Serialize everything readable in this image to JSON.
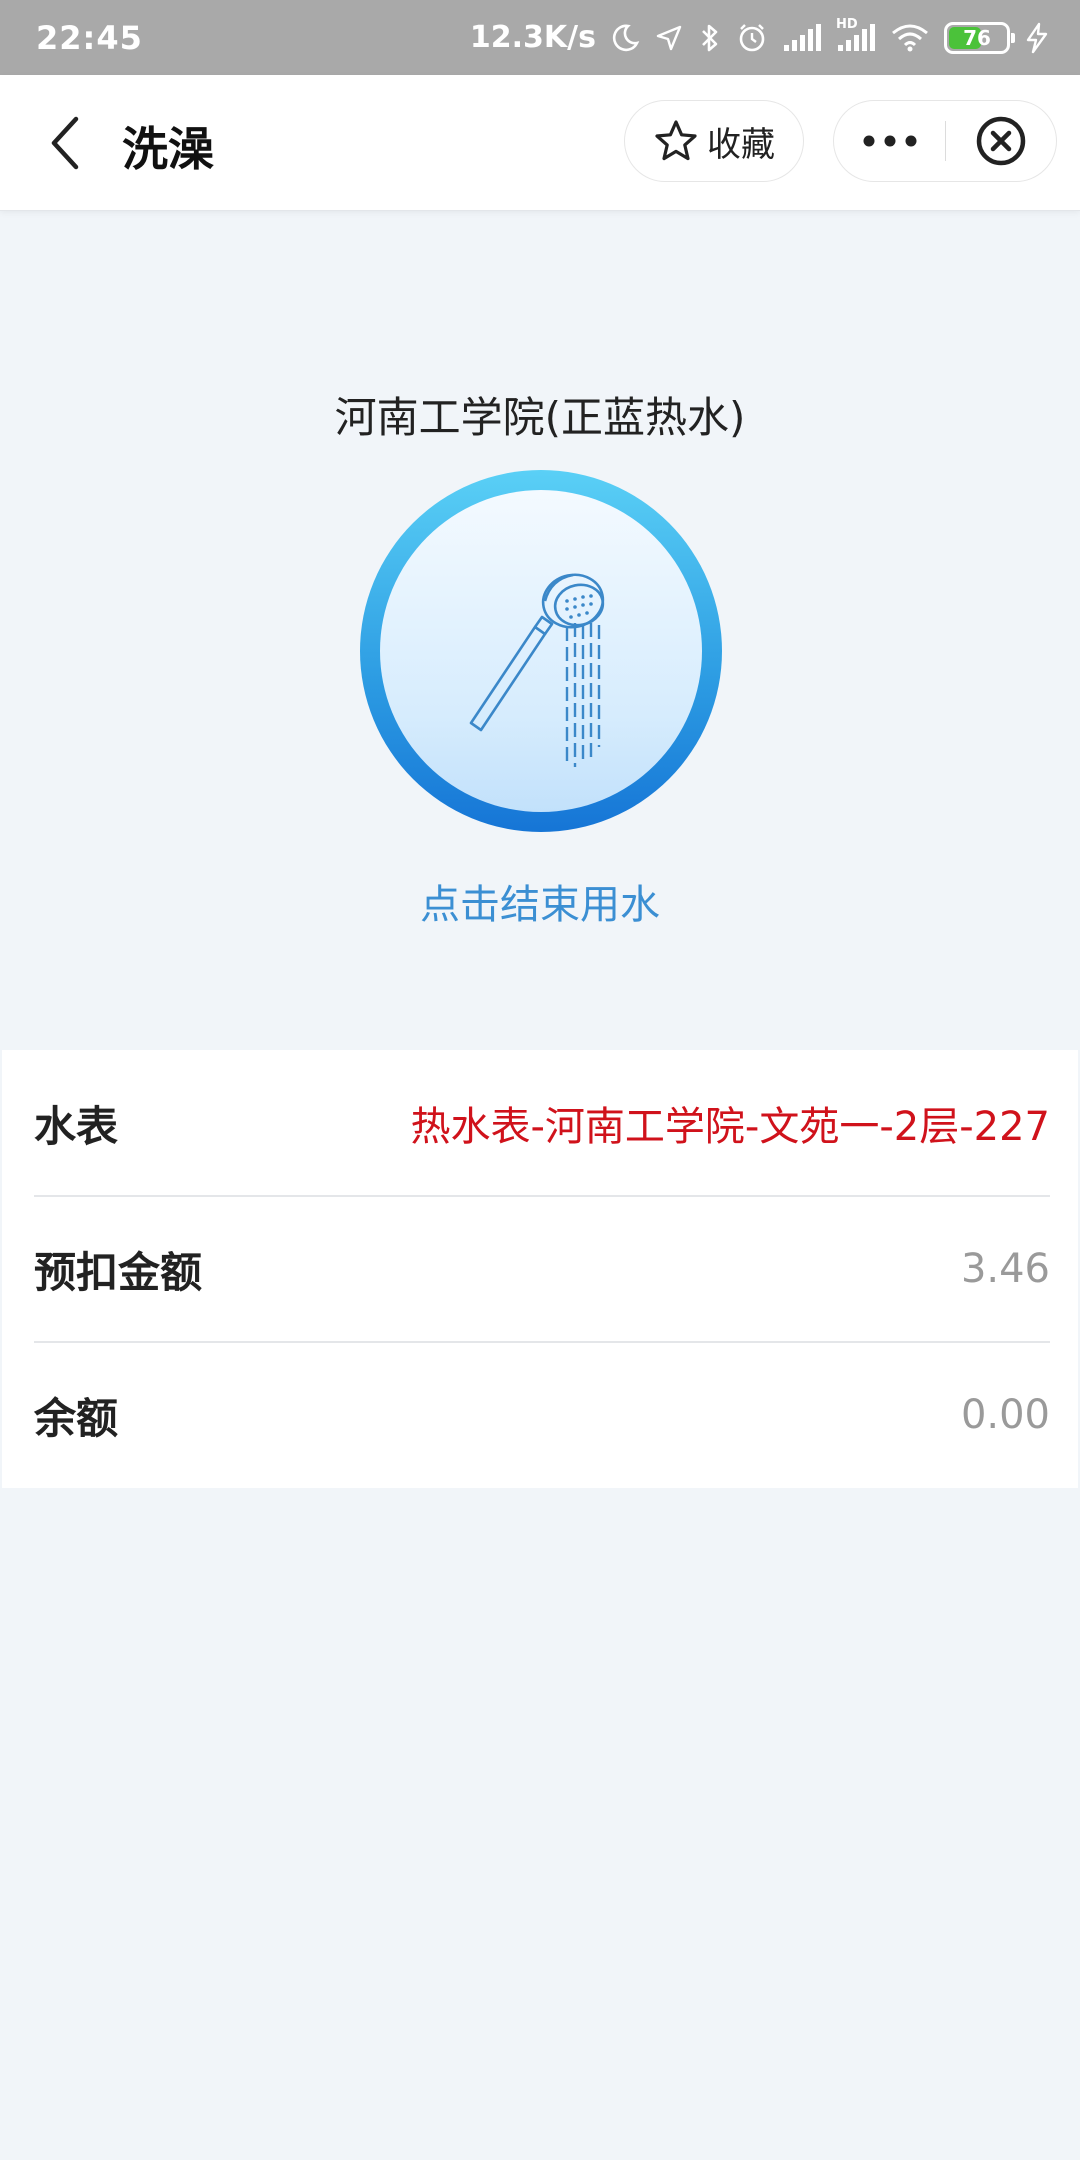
{
  "status_bar": {
    "time": "22:45",
    "network_speed": "12.3K/s",
    "icons": [
      "moon-icon",
      "location-icon",
      "bluetooth-icon",
      "alarm-icon",
      "signal-icon",
      "hd-signal-icon",
      "wifi-icon",
      "battery-icon",
      "charging-icon"
    ],
    "hd_label": "HD",
    "battery_level": "76"
  },
  "nav": {
    "title": "洗澡",
    "favorite_label": "收藏"
  },
  "main": {
    "school_name": "河南工学院(正蓝热水)",
    "action_text": "点击结束用水"
  },
  "info": {
    "rows": [
      {
        "label": "水表",
        "value": "热水表-河南工学院-文苑一-2层-227"
      },
      {
        "label": "预扣金额",
        "value": "3.46"
      },
      {
        "label": "余额",
        "value": "0.00"
      }
    ]
  },
  "colors": {
    "accent_blue": "#3b8fd3",
    "value_red": "#d0121b",
    "background": "#f1f5f9"
  }
}
